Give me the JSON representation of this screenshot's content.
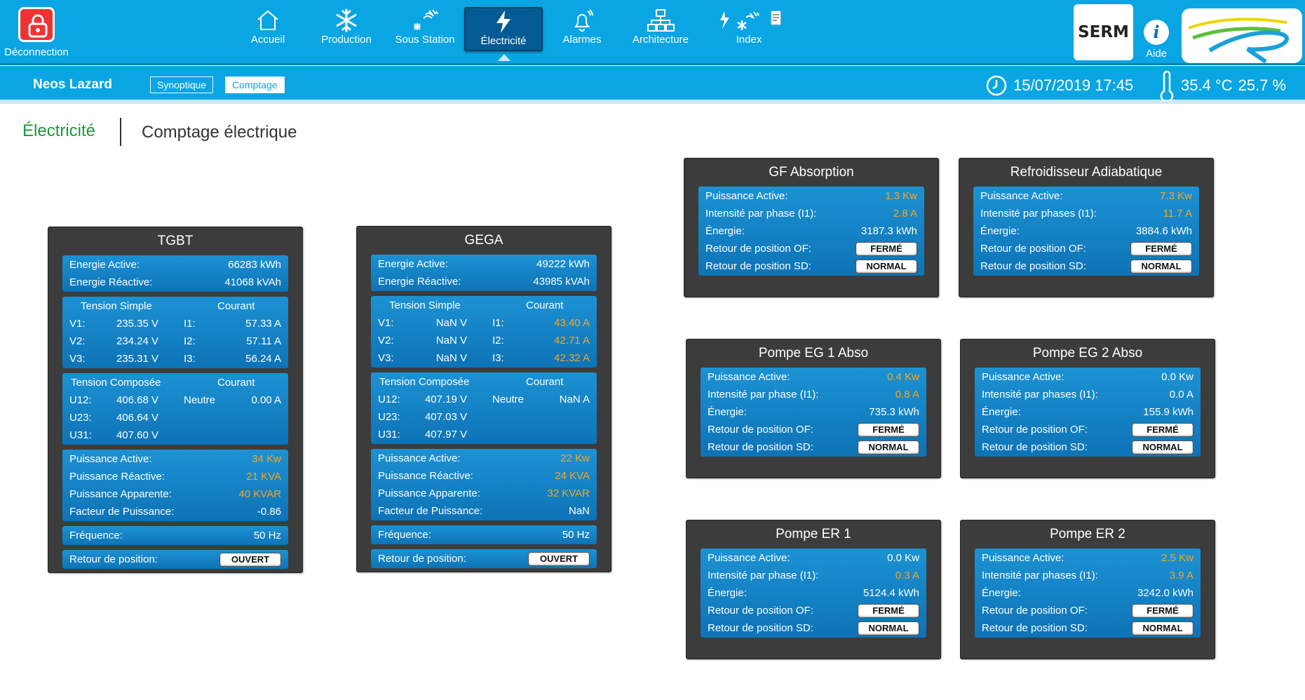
{
  "header": {
    "logout_label": "Déconnection",
    "nav": [
      {
        "label": "Accueil",
        "icon": "home-icon"
      },
      {
        "label": "Production",
        "icon": "snowflake-icon"
      },
      {
        "label": "Sous Station",
        "icon": "substation-icon"
      },
      {
        "label": "Électricité",
        "icon": "lightning-icon",
        "active": true
      },
      {
        "label": "Alarmes",
        "icon": "bell-icon"
      },
      {
        "label": "Architecture",
        "icon": "network-icon"
      },
      {
        "label": "Index",
        "icon": "index-icon"
      }
    ],
    "serm_logo_text": "SERM",
    "help_label": "Aide"
  },
  "subbar": {
    "site_name": "Neos Lazard",
    "tabs": [
      "Synoptique",
      "Comptage"
    ],
    "active_tab": "Comptage",
    "datetime": "15/07/2019 17:45",
    "temperature": "35.4 °C",
    "humidity": "25.7 %"
  },
  "breadcrumb": {
    "section": "Électricité",
    "page": "Comptage électrique"
  },
  "colors": {
    "accent": "#0aa5e3",
    "highlight": "#f5a623",
    "green": "#1b9a3a",
    "panel": "#3c3c3c"
  },
  "tgbt": {
    "title": "TGBT",
    "energie_active_label": "Energie Active:",
    "energie_active": "66283 kWh",
    "energie_reactive_label": "Energie Réactive:",
    "energie_reactive": "41068 kVAh",
    "tension_simple_label": "Tension Simple",
    "courant_label": "Courant",
    "v1_label": "V1:",
    "v1": "235.35 V",
    "i1_label": "I1:",
    "i1": "57.33 A",
    "v2_label": "V2:",
    "v2": "234.24 V",
    "i2_label": "I2:",
    "i2": "57.11 A",
    "v3_label": "V3:",
    "v3": "235.31 V",
    "i3_label": "I3:",
    "i3": "56.24 A",
    "tension_composee_label": "Tension Composée",
    "courant2_label": "Courant",
    "u12_label": "U12:",
    "u12": "406.68 V",
    "neutre_label": "Neutre",
    "neutre": "0.00 A",
    "u23_label": "U23:",
    "u23": "406.64 V",
    "u31_label": "U31:",
    "u31": "407.60 V",
    "p_active_label": "Puissance Active:",
    "p_active": "34 Kw",
    "p_reactive_label": "Puissance Réactive:",
    "p_reactive": "21 KVA",
    "p_apparente_label": "Puissance Apparente:",
    "p_apparente": "40 KVAR",
    "facteur_label": "Facteur de Puissance:",
    "facteur": "-0.86",
    "frequence_label": "Fréquence:",
    "frequence": "50 Hz",
    "retour_label": "Retour de position:",
    "retour": "OUVERT"
  },
  "gega": {
    "title": "GEGA",
    "energie_active_label": "Energie Active:",
    "energie_active": "49222 kWh",
    "energie_reactive_label": "Energie Réactive:",
    "energie_reactive": "43985 kVAh",
    "tension_simple_label": "Tension Simple",
    "courant_label": "Courant",
    "v1_label": "V1:",
    "v1": "NaN V",
    "i1_label": "I1:",
    "i1": "43.40 A",
    "v2_label": "V2:",
    "v2": "NaN V",
    "i2_label": "I2:",
    "i2": "42.71 A",
    "v3_label": "V3:",
    "v3": "NaN V",
    "i3_label": "I3:",
    "i3": "42.32 A",
    "tension_composee_label": "Tension Composée",
    "courant2_label": "Courant",
    "u12_label": "U12:",
    "u12": "407.19 V",
    "neutre_label": "Neutre",
    "neutre": "NaN A",
    "u23_label": "U23:",
    "u23": "407.03 V",
    "u31_label": "U31:",
    "u31": "407.97 V",
    "p_active_label": "Puissance Active:",
    "p_active": "22 Kw",
    "p_reactive_label": "Puissance Réactive:",
    "p_reactive": "24 KVA",
    "p_apparente_label": "Puissance Apparente:",
    "p_apparente": "32 KVAR",
    "facteur_label": "Facteur de Puissance:",
    "facteur": "NaN",
    "frequence_label": "Fréquence:",
    "frequence": "50 Hz",
    "retour_label": "Retour de position:",
    "retour": "OUVERT"
  },
  "equip": {
    "gf_absorption": {
      "title": "GF Absorption",
      "pa_label": "Puissance Active:",
      "pa": "1.3 Kw",
      "i_label": "Intensité par phase (I1):",
      "i": "2.8 A",
      "e_label": "Énergie:",
      "e": "3187.3 kWh",
      "of_label": "Retour de position OF:",
      "of": "FERMÉ",
      "sd_label": "Retour de position SD:",
      "sd": "NORMAL"
    },
    "refroidisseur": {
      "title": "Refroidisseur Adiabatique",
      "pa_label": "Puissance Active:",
      "pa": "7.3 Kw",
      "i_label": "Intensité par phases (I1):",
      "i": "11.7 A",
      "e_label": "Énergie:",
      "e": "3884.6 kWh",
      "of_label": "Retour de position OF:",
      "of": "FERMÉ",
      "sd_label": "Retour de position SD:",
      "sd": "NORMAL"
    },
    "pompe_eg1": {
      "title": "Pompe EG 1 Abso",
      "pa_label": "Puissance Active:",
      "pa": "0.4 Kw",
      "i_label": "Intensité par phase (I1):",
      "i": "0.8 A",
      "e_label": "Énergie:",
      "e": "735.3 kWh",
      "of_label": "Retour de position OF:",
      "of": "FERMÉ",
      "sd_label": "Retour de position SD:",
      "sd": "NORMAL"
    },
    "pompe_eg2": {
      "title": "Pompe EG 2 Abso",
      "pa_label": "Puissance Active:",
      "pa": "0.0 Kw",
      "i_label": "Intensité par phases (I1):",
      "i": "0.0 A",
      "e_label": "Énergie:",
      "e": "155.9 kWh",
      "of_label": "Retour de position OF:",
      "of": "FERMÉ",
      "sd_label": "Retour de position SD:",
      "sd": "NORMAL"
    },
    "pompe_er1": {
      "title": "Pompe ER 1",
      "pa_label": "Puissance Active:",
      "pa": "0.0 Kw",
      "i_label": "Intensité par phase (I1):",
      "i": "0.3 A",
      "e_label": "Énergie:",
      "e": "5124.4 kWh",
      "of_label": "Retour de position OF:",
      "of": "FERMÉ",
      "sd_label": "Retour de position SD:",
      "sd": "NORMAL"
    },
    "pompe_er2": {
      "title": "Pompe ER 2",
      "pa_label": "Puissance Active:",
      "pa": "2.5 Kw",
      "i_label": "Intensité par phases (I1):",
      "i": "3.9 A",
      "e_label": "Énergie:",
      "e": "3242.0 kWh",
      "of_label": "Retour de position OF:",
      "of": "FERMÉ",
      "sd_label": "Retour de position SD:",
      "sd": "NORMAL"
    }
  }
}
